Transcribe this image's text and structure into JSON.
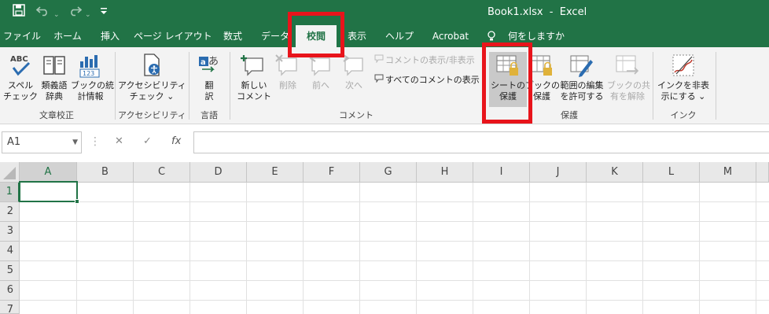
{
  "titlebar": {
    "title": "Book1.xlsx  -  Excel",
    "save_icon": "save-icon",
    "undo_icon": "undo-icon",
    "redo_icon": "redo-icon",
    "customize_icon": "customize-qat-icon",
    "bg_color": "#217346"
  },
  "tabs": [
    {
      "label": "ファイル"
    },
    {
      "label": "ホーム"
    },
    {
      "label": "挿入"
    },
    {
      "label": "ページ レイアウト"
    },
    {
      "label": "数式"
    },
    {
      "label": "データ"
    },
    {
      "label": "校閲",
      "active": true
    },
    {
      "label": "表示"
    },
    {
      "label": "ヘルプ"
    },
    {
      "label": "Acrobat"
    },
    {
      "label": "何をしますか"
    }
  ],
  "ribbon": {
    "groups": {
      "proofing": "文章校正",
      "accessibility": "アクセシビリティ",
      "language": "言語",
      "comments": "コメント",
      "protect": "保護",
      "ink": "インク"
    },
    "buttons": {
      "spelling": [
        "スペル",
        "チェック"
      ],
      "thesaurus": [
        "類義語",
        "辞典"
      ],
      "workbook_stats": [
        "ブックの統",
        "計情報"
      ],
      "accessibility_check": [
        "アクセシビリティ",
        "チェック ⌄"
      ],
      "translate": [
        "翻",
        "訳"
      ],
      "new_comment": [
        "新しい",
        "コメント"
      ],
      "delete": [
        "削除"
      ],
      "previous": [
        "前へ"
      ],
      "next": [
        "次へ"
      ],
      "show_hide_comment": "コメントの表示/非表示",
      "show_all_comments": "すべてのコメントの表示",
      "protect_sheet": [
        "シートの",
        "保護"
      ],
      "protect_workbook": [
        "ブックの",
        "保護"
      ],
      "allow_edit_ranges": [
        "範囲の編集",
        "を許可する"
      ],
      "unshare_workbook": [
        "ブックの共",
        "有を解除"
      ],
      "hide_ink": [
        "インクを非表",
        "示にする ⌄"
      ]
    }
  },
  "formula_bar": {
    "name_box": "A1",
    "cancel": "✕",
    "enter": "✓",
    "fx": "fx",
    "value": ""
  },
  "grid": {
    "columns": [
      "A",
      "B",
      "C",
      "D",
      "E",
      "F",
      "G",
      "H",
      "I",
      "J",
      "K",
      "L",
      "M"
    ],
    "rows": [
      "1",
      "2",
      "3",
      "4",
      "5",
      "6",
      "7"
    ],
    "active_cell": "A1"
  },
  "colors": {
    "accent": "#217346",
    "highlight_box": "#e8141b"
  }
}
